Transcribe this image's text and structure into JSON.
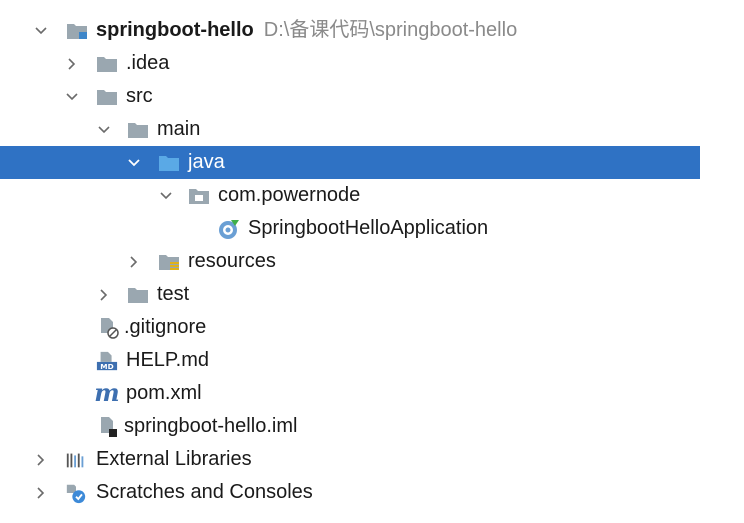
{
  "tree": {
    "project": {
      "name": "springboot-hello",
      "path": "D:\\备课代码\\springboot-hello"
    },
    "idea": ".idea",
    "src": "src",
    "main": "main",
    "java": "java",
    "package": "com.powernode",
    "app_class": "SpringbootHelloApplication",
    "resources": "resources",
    "test": "test",
    "gitignore": ".gitignore",
    "help_md": "HELP.md",
    "pom": "pom.xml",
    "iml": "springboot-hello.iml",
    "external_libraries": "External Libraries",
    "scratches": "Scratches and Consoles",
    "md_badge": "MD",
    "maven_glyph": "m"
  },
  "colors": {
    "selection": "#2f72c4",
    "folder": "#9aa7b0",
    "source_folder": "#5aa9e6",
    "path_text": "#8a8a8a"
  }
}
